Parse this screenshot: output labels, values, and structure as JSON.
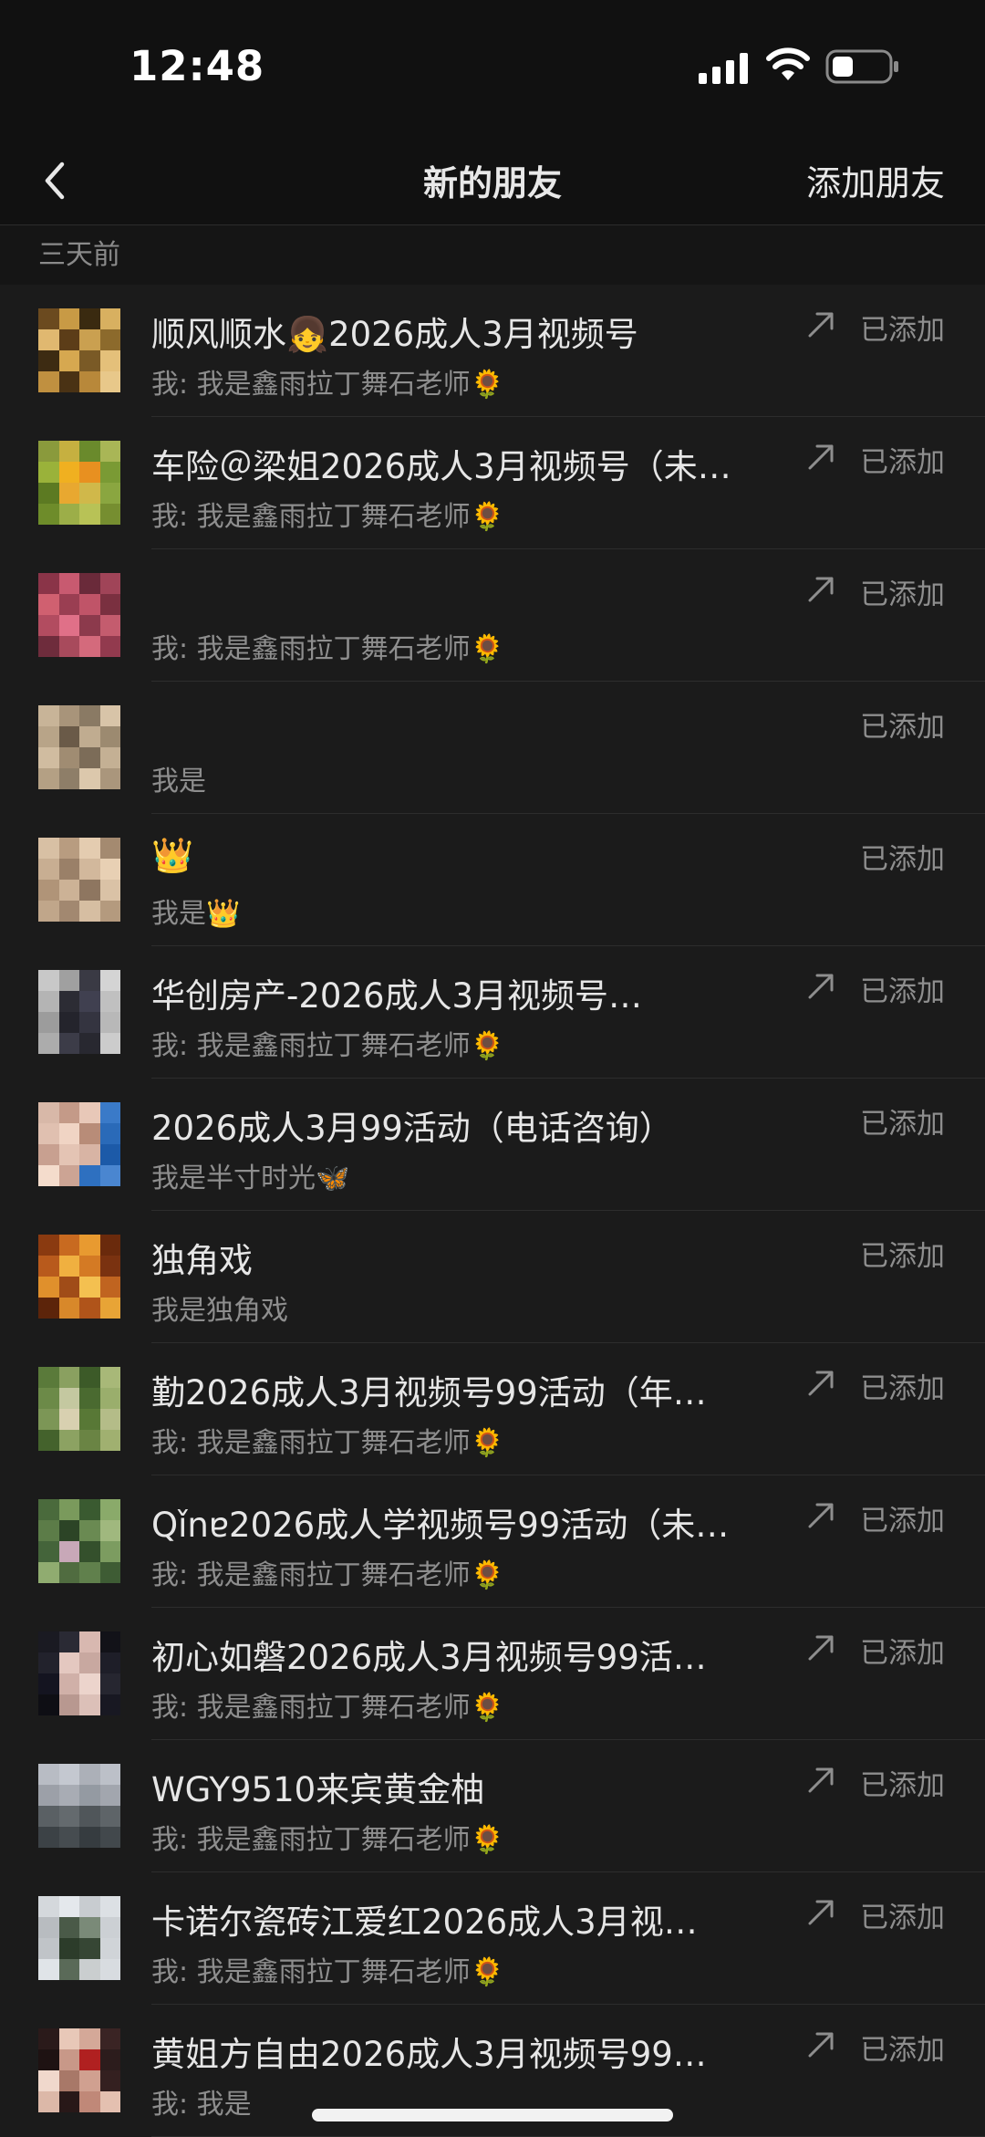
{
  "status_bar": {
    "time": "12:48"
  },
  "nav": {
    "title": "新的朋友",
    "add_friend": "添加朋友"
  },
  "section": {
    "header": "三天前"
  },
  "rows": [
    {
      "name": "顺风顺水👧2026成人3月视频号",
      "msg": "我: 我是鑫雨拉丁舞石老师🌻",
      "status": "已添加",
      "arrow": true,
      "avatar": [
        "#6b4a1f",
        "#c89a45",
        "#3a2a10",
        "#d8b060",
        "#e0b870",
        "#5c3d18",
        "#caa050",
        "#8c6a2c",
        "#3d2b12",
        "#d6a850",
        "#7a5a26",
        "#e4c07a",
        "#c09040",
        "#4a3214",
        "#b8883a",
        "#e8c88a"
      ]
    },
    {
      "name": "车险＠梁姐2026成人3月视频号（未…",
      "msg": "我: 我是鑫雨拉丁舞石老师🌻",
      "status": "已添加",
      "arrow": true,
      "avatar": [
        "#8a9a3c",
        "#c6b040",
        "#6a8a2c",
        "#a9b656",
        "#9ab23a",
        "#f0b020",
        "#e89020",
        "#7a9a34",
        "#5c7a22",
        "#e8a830",
        "#d0b84a",
        "#8aa640",
        "#6e8c2a",
        "#9cae48",
        "#b8c256",
        "#768e30"
      ]
    },
    {
      "name": "",
      "msg": "我: 我是鑫雨拉丁舞石老师🌻",
      "status": "已添加",
      "arrow": true,
      "avatar": [
        "#8a3448",
        "#c85a70",
        "#6a2a3a",
        "#a04458",
        "#d06070",
        "#9a3e52",
        "#c05468",
        "#7a3040",
        "#b24c60",
        "#e07088",
        "#8c3a4c",
        "#c45c6e",
        "#6e2c3c",
        "#a84a5c",
        "#d46a7c",
        "#923a4e"
      ]
    },
    {
      "name": "",
      "msg": "我是",
      "status": "已添加",
      "arrow": false,
      "avatar": [
        "#c8b498",
        "#a8947a",
        "#8a7a64",
        "#d8c4a8",
        "#b8a488",
        "#6a5a48",
        "#c0ac90",
        "#9c8a70",
        "#d0bca0",
        "#a08c72",
        "#7c6c58",
        "#c4b094",
        "#b4a084",
        "#8e7e68",
        "#dcc8ac",
        "#aa967c"
      ]
    },
    {
      "name": "👑",
      "msg": "我是👑",
      "status": "已添加",
      "arrow": false,
      "avatar": [
        "#d8c0a4",
        "#b89c80",
        "#e4ccb0",
        "#a48a70",
        "#c8ae92",
        "#9a8068",
        "#d2b89c",
        "#e8d0b4",
        "#b09478",
        "#ccb296",
        "#8e7660",
        "#dac2a6",
        "#c0a68a",
        "#a28870",
        "#d6bea2",
        "#b49a7e"
      ]
    },
    {
      "name": "华创房产-2026成人3月视频号…",
      "msg": "我: 我是鑫雨拉丁舞石老师🌻",
      "status": "已添加",
      "arrow": true,
      "avatar": [
        "#c8c8c8",
        "#a0a0a0",
        "#3a3a44",
        "#d4d4d4",
        "#b4b4b4",
        "#2c2c34",
        "#404050",
        "#c0c0c0",
        "#9c9c9c",
        "#24242c",
        "#343440",
        "#b8b8b8",
        "#acacac",
        "#3c3c48",
        "#282830",
        "#cccccc"
      ]
    },
    {
      "name": "2026成人3月99活动（电话咨询）",
      "msg": "我是半寸时光🦋",
      "status": "已添加",
      "arrow": false,
      "avatar": [
        "#d8b8a8",
        "#c49a88",
        "#e8c8b8",
        "#3a7ac8",
        "#e0c0b0",
        "#f0d4c4",
        "#b88c78",
        "#2a6ab8",
        "#c8a090",
        "#e4c4b4",
        "#d8b4a4",
        "#1c5aa8",
        "#f4dccc",
        "#cca494",
        "#2e70c0",
        "#4a86d0"
      ]
    },
    {
      "name": "独角戏",
      "msg": "我是独角戏",
      "status": "已添加",
      "arrow": false,
      "avatar": [
        "#8a3a10",
        "#c86a20",
        "#e89a30",
        "#6a2a0c",
        "#b85a1c",
        "#f0b040",
        "#d47a24",
        "#7a3210",
        "#e0902c",
        "#a04c18",
        "#f4c050",
        "#c06420",
        "#5c240a",
        "#d8882a",
        "#b0541a",
        "#e8a436"
      ]
    },
    {
      "name": "勤2026成人3月视频号99活动（年…",
      "msg": "我: 我是鑫雨拉丁舞石老师🌻",
      "status": "已添加",
      "arrow": true,
      "avatar": [
        "#5a7a3a",
        "#8aa060",
        "#3c5a28",
        "#a8b878",
        "#6c8a48",
        "#c4c8a0",
        "#4a6a30",
        "#9aae6c",
        "#7c9656",
        "#d8d0b0",
        "#587836",
        "#b4bc88",
        "#44622c",
        "#8ca262",
        "#6a8444",
        "#a0b070"
      ]
    },
    {
      "name": "Qǐnɐ2026成人学视频号99活动（未…",
      "msg": "我: 我是鑫雨拉丁舞石老师🌻",
      "status": "已添加",
      "arrow": true,
      "avatar": [
        "#4a6a3c",
        "#7a9a5c",
        "#3a5a30",
        "#8aaa6a",
        "#5c7c48",
        "#2c4426",
        "#6a8a52",
        "#a0b87e",
        "#44643a",
        "#c8a8b8",
        "#34502c",
        "#7c9c60",
        "#90ac70",
        "#506c40",
        "#60804c",
        "#3e5c34"
      ]
    },
    {
      "name": "初心如磐2026成人3月视频号99活…",
      "msg": "我: 我是鑫雨拉丁舞石老师🌻",
      "status": "已添加",
      "arrow": true,
      "avatar": [
        "#1a1a22",
        "#2a2a34",
        "#d8b8b0",
        "#121218",
        "#22222c",
        "#e4c8c0",
        "#c8a8a0",
        "#1e1e28",
        "#141420",
        "#d0b0a8",
        "#ecd4cc",
        "#262630",
        "#0e0e14",
        "#b89890",
        "#dcc0b8",
        "#181822"
      ]
    },
    {
      "name": "WGY9510来宾黄金柚",
      "msg": "我: 我是鑫雨拉丁舞石老师🌻",
      "status": "已添加",
      "arrow": true,
      "avatar": [
        "#b8bcc4",
        "#c4c8d0",
        "#acb0b8",
        "#bcc0c8",
        "#9ca0a8",
        "#a8acb4",
        "#949aa2",
        "#a2a6ae",
        "#5a6064",
        "#646a6e",
        "#50565a",
        "#5e6468",
        "#3c4246",
        "#464c50",
        "#363c40",
        "#42484c"
      ]
    },
    {
      "name": "卡诺尔瓷砖江爱红2026成人3月视…",
      "msg": "我: 我是鑫雨拉丁舞石老师🌻",
      "status": "已添加",
      "arrow": true,
      "avatar": [
        "#d4d8dc",
        "#e4e8ec",
        "#c8ccd0",
        "#dce0e4",
        "#b8bcc0",
        "#4a5a48",
        "#7a8a78",
        "#ccd0d4",
        "#c0c4c8",
        "#2c3c2a",
        "#364634",
        "#d0d4d8",
        "#e0e4e8",
        "#5a6a58",
        "#cacecf",
        "#d8dce0"
      ]
    },
    {
      "name": "黄姐方自由2026成人3月视频号99…",
      "msg": "我: 我是",
      "status": "已添加",
      "arrow": true,
      "avatar": [
        "#2a1a1a",
        "#e8c8b8",
        "#d4a898",
        "#3a2424",
        "#1e1212",
        "#c89888",
        "#b02020",
        "#2c1c1c",
        "#f0d8cc",
        "#a87868",
        "#d0a090",
        "#342020",
        "#dcb8a8",
        "#281818",
        "#c08878",
        "#e4c0b0"
      ]
    }
  ]
}
